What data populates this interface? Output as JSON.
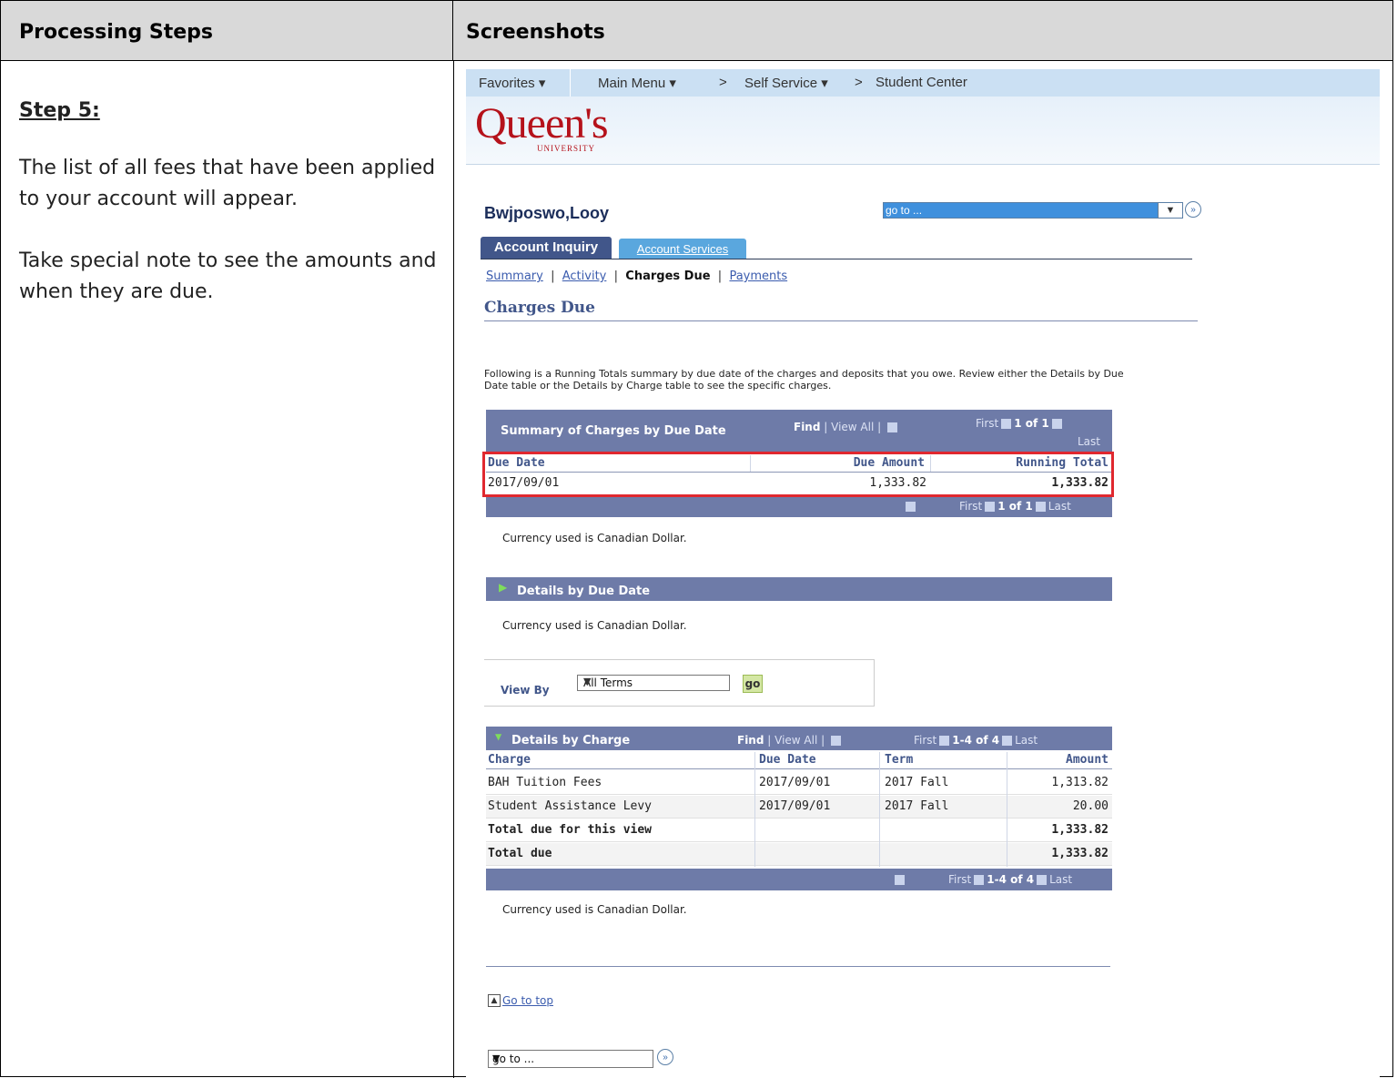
{
  "headers": {
    "left": "Processing Steps",
    "right": "Screenshots"
  },
  "steps": {
    "title": "Step 5:",
    "para1": "The list of all fees that have been applied to your account will appear.",
    "para2": "Take special note to see the amounts and when they are due."
  },
  "nav": {
    "favorites": "Favorites ▾",
    "main_menu": "Main Menu ▾",
    "sep1": ">",
    "self_service": "Self Service ▾",
    "sep2": ">",
    "student_center": "Student Center"
  },
  "logo": {
    "text": "Queen's",
    "sub": "UNIVERSITY"
  },
  "student_name": "Bwjposwo,Looy",
  "goto_top_select": "go to ...",
  "tabs": {
    "active": "Account Inquiry",
    "other": "Account Services"
  },
  "sublinks": {
    "summary": "Summary",
    "activity": "Activity",
    "charges_due": "Charges Due",
    "payments": "Payments",
    "sep": "|"
  },
  "page_title": "Charges Due",
  "intro": "Following is a Running Totals summary by due date of the charges and deposits that you owe.  Review either the Details by Due Date table or the Details by Charge table to see the specific charges.",
  "summary_grid": {
    "caption": "Summary of Charges by Due Date",
    "find": "Find",
    "view_all": "View All",
    "first": "First",
    "count": "1 of 1",
    "last": "Last",
    "headers": [
      "Due Date",
      "Due Amount",
      "Running Total"
    ],
    "rows": [
      [
        "2017/09/01",
        "1,333.82",
        "1,333.82"
      ]
    ],
    "footer_first": "First",
    "footer_count": "1 of 1",
    "footer_last": "Last"
  },
  "currency_note": "Currency used is Canadian Dollar.",
  "details_due": {
    "caption": "Details by Due Date"
  },
  "view_by": {
    "label": "View By",
    "selected": "All Terms",
    "go": "go"
  },
  "details_charge": {
    "caption": "Details by Charge",
    "find": "Find",
    "view_all": "View All",
    "first": "First",
    "count": "1-4 of 4",
    "last": "Last",
    "headers": [
      "Charge",
      "Due Date",
      "Term",
      "Amount"
    ],
    "rows": [
      [
        "BAH Tuition Fees",
        "2017/09/01",
        "2017 Fall",
        "1,313.82"
      ],
      [
        "Student Assistance Levy",
        "2017/09/01",
        "2017 Fall",
        "20.00"
      ],
      [
        "Total due for this view",
        "",
        "",
        "1,333.82"
      ],
      [
        "Total due",
        "",
        "",
        "1,333.82"
      ]
    ],
    "footer_first": "First",
    "footer_count": "1-4 of 4",
    "footer_last": "Last"
  },
  "go_to_top": "Go to top",
  "goto_bottom_select": "go to ..."
}
